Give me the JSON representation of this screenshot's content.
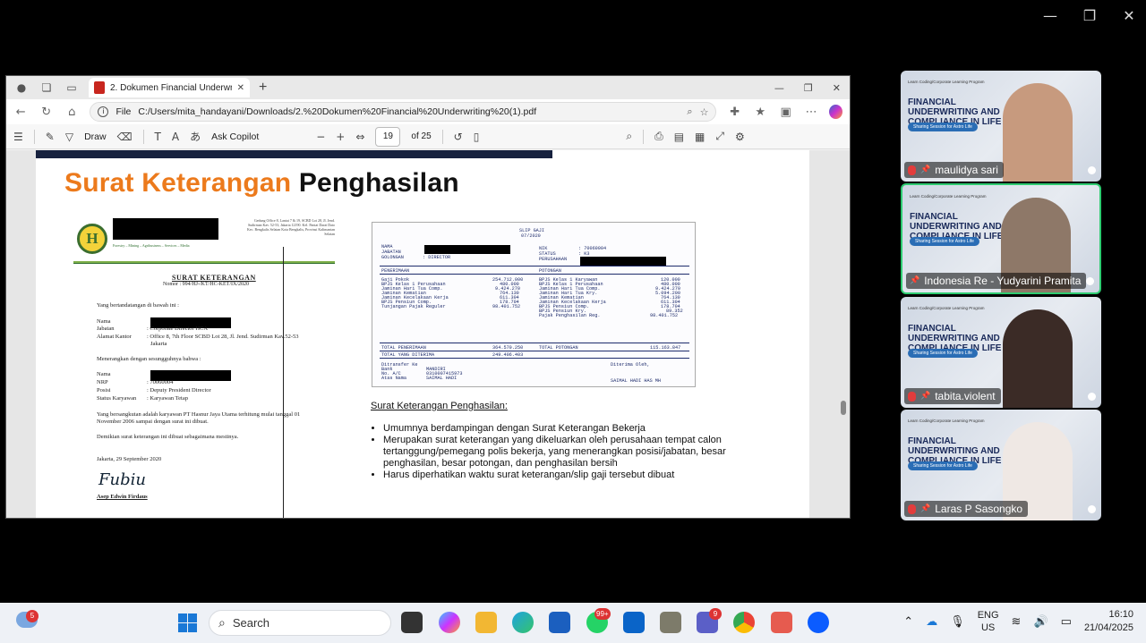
{
  "zoom_window": {
    "minimize": "—",
    "restore": "❐",
    "close": "✕"
  },
  "browser": {
    "tab_title": "2. Dokumen Financial Underwriting",
    "tab_close": "✕",
    "new_tab": "+",
    "url_prefix": "File",
    "url": "C:/Users/mita_handayani/Downloads/2.%20Dokumen%20Financial%20Underwriting%20(1).pdf",
    "window_controls": {
      "minimize": "—",
      "restore": "❐",
      "close": "✕"
    }
  },
  "pdf_toolbar": {
    "draw_label": "Draw",
    "ask_copilot": "Ask Copilot",
    "zoom_out": "−",
    "zoom_in": "+",
    "page_current": "19",
    "page_total": "of 25"
  },
  "slide": {
    "title_orange": "Surat Keterangan",
    "title_black": "Penghasilan",
    "letter": {
      "logo_text": "H",
      "tagline": "Forestry – Mining – Agribusiness – Services – Media",
      "address": "Gedung Office 8, Lantai 7 & 19, SCBD Lot 28, Jl. Jend. Sudirman Kav. 52-53, Jakarta 12190. Kel. Pantai Darat Dato Kec. Bengkalis Selatan Kota Bengkalis, Provinsi Kalimantan Selatan",
      "title": "SURAT KETERANGAN",
      "number": "Nomor : 994/HJ-/KT/HC-KET/IX/2020",
      "intro": "Yang bertandatangan di bawah ini :",
      "label_nama": "Nama",
      "label_jabatan": "Jabatan",
      "value_jabatan": ": Corporate Director HCA",
      "label_alamat": "Alamat Kantor",
      "value_alamat": ": Office 8, 7th Floor SCBD Lot 28, Jl. Jend. Sudirman Kav.52-53",
      "value_alamat2": "Jakarta",
      "declare": "Menerangkan dengan sesungguhnya bahwa :",
      "label_nama2": "Nama",
      "label_nrp": "NRP",
      "value_nrp": ": 70060004",
      "label_posisi": "Posisi",
      "value_posisi": ": Deputy President Director",
      "label_status": "Status Karyawan",
      "value_status": ": Karyawan Tetap",
      "body1": "Yang bersangkutan adalah karyawan PT Hasnur Jaya Utama terhitung mulai tanggal 01",
      "body2": "November 2006 sampai dengan surat ini dibuat.",
      "closing": "Demikian surat keterangan ini dibuat sebagaimana mestinya.",
      "place_date": "Jakarta, 29 September 2020",
      "signature": "Fubiu",
      "signer": "Asep Edwin Firdaus"
    },
    "slip": {
      "title": "SLIP GAJI",
      "period": "07/2020",
      "label_nama": "NAMA",
      "label_jabatan": "JABATAN",
      "label_golongan": "GOLONGAN",
      "value_golongan": ": DIRECTOR",
      "label_nik": "NIK",
      "value_nik": ": 70060004",
      "label_status": "STATUS",
      "value_status": ": K3",
      "label_perusahaan": "PERUSAHAAN",
      "head_penerimaan": "PENERIMAAN",
      "head_potongan": "POTONGAN",
      "earn_labels": [
        "Gaji Pokok",
        "BPJS Kelas 1 Perusahaan",
        "Jaminan Hari Tua Comp.",
        "Jaminan Kematian",
        "Jaminan Kecelakaan Kerja",
        "BPJS Pensiun Comp.",
        "Tunjangan Pajak Reguler"
      ],
      "earn_values": [
        "254.712.000",
        "480.000",
        "9.424.270",
        "764.130",
        "611.304",
        "178.704",
        "98.401.752"
      ],
      "ded_labels": [
        "BPJS Kelas 1 Karyawan",
        "BPJS Kelas 1 Perusahaan",
        "Jaminan Hari Tua Comp.",
        "Jaminan Hari Tua Kry.",
        "Jaminan Kematian",
        "Jaminan Kecelakaan Kerja",
        "BPJS Pensiun Comp.",
        "BPJS Pensiun Kry.",
        "Pajak Penghasilan Reg."
      ],
      "ded_values": [
        "120.000",
        "480.000",
        "9.424.270",
        "5.094.200",
        "764.130",
        "611.304",
        "178.704",
        "89.352",
        "98.401.752"
      ],
      "total_pen_label": "TOTAL PENERIMAAN",
      "total_pen_value": "364.570.250",
      "total_pot_label": "TOTAL POTONGAN",
      "total_pot_value": "115.163.847",
      "total_dit_label": "TOTAL YANG DITERIMA",
      "total_dit_value": "249.406.403",
      "transfer_label": "Ditransfer Ke",
      "bank_label": "Bank",
      "bank_value": "MANDIRI",
      "account_label": "No. A/C",
      "account_value": "0310007415973",
      "holder_label": "Atas Nama",
      "holder_value": "SAIMAL HADI",
      "received_by": "Diterima Oleh,",
      "receiver": "SAIMAL HADI HAS MH"
    },
    "explanation": {
      "heading": "Surat Keterangan Penghasilan:",
      "bullets": [
        "Umumnya berdampingan dengan Surat Keterangan Bekerja",
        "Merupakan surat keterangan yang dikeluarkan oleh perusahaan tempat calon tertanggung/pemegang polis bekerja, yang menerangkan posisi/jabatan, besar penghasilan, besar potongan, dan penghasilan bersih",
        "Harus diperhatikan waktu surat keterangan/slip gaji tersebut dibuat"
      ]
    }
  },
  "participants": [
    {
      "name": "maulidya sari",
      "program": "Learn Coding/Corporate Learning Program",
      "title": "FINANCIAL UNDERWRITING AND COMPLIANCE IN LIFE",
      "pill": "Sharing Session for Astro Life",
      "face_color": "#c79a7e"
    },
    {
      "name": "Indonesia Re - Yudyarini Pramita",
      "program": "Learn Coding/Corporate Learning Program",
      "title": "FINANCIAL UNDERWRITING AND COMPLIANCE IN LIFE",
      "pill": "Sharing Session for Astro Life",
      "face_color": "#8e7868"
    },
    {
      "name": "tabita.violent",
      "program": "Learn Coding/Corporate Learning Program",
      "title": "FINANCIAL UNDERWRITING AND COMPLIANCE IN LIFE",
      "pill": "Sharing Session for Astro Life",
      "face_color": "#3b2b26"
    },
    {
      "name": "Laras P Sasongko",
      "program": "Learn Coding/Corporate Learning Program",
      "title": "FINANCIAL UNDERWRITING AND COMPLIANCE IN LIFE",
      "pill": "Sharing Session for Astro Life",
      "face_color": "#efe8e4"
    }
  ],
  "taskbar": {
    "weather_badge": "5",
    "search_placeholder": "Search",
    "whatsapp_badge": "99+",
    "teams_badge": "9",
    "lang_line1": "ENG",
    "lang_line2": "US",
    "time": "16:10",
    "date": "21/04/2025"
  }
}
